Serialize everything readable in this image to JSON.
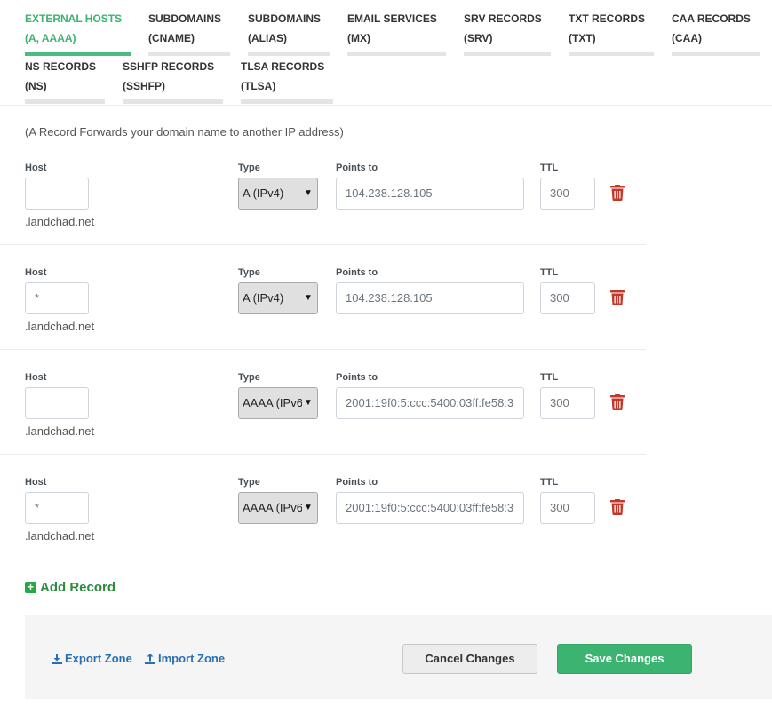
{
  "tabs": [
    {
      "line1": "EXTERNAL HOSTS",
      "line2": "(A, AAAA)",
      "active": true
    },
    {
      "line1": "SUBDOMAINS",
      "line2": "(CNAME)",
      "active": false
    },
    {
      "line1": "SUBDOMAINS",
      "line2": "(ALIAS)",
      "active": false
    },
    {
      "line1": "EMAIL SERVICES",
      "line2": "(MX)",
      "active": false
    },
    {
      "line1": "SRV RECORDS",
      "line2": "(SRV)",
      "active": false
    },
    {
      "line1": "TXT RECORDS",
      "line2": "(TXT)",
      "active": false
    },
    {
      "line1": "CAA RECORDS",
      "line2": "(CAA)",
      "active": false
    },
    {
      "line1": "NS RECORDS",
      "line2": "(NS)",
      "active": false
    },
    {
      "line1": "SSHFP RECORDS",
      "line2": "(SSHFP)",
      "active": false
    },
    {
      "line1": "TLSA RECORDS",
      "line2": "(TLSA)",
      "active": false
    }
  ],
  "description": "(A Record Forwards your domain name to another IP address)",
  "labels": {
    "host": "Host",
    "type": "Type",
    "points_to": "Points to",
    "ttl": "TTL"
  },
  "domain_suffix": ".landchad.net",
  "records": [
    {
      "host": "",
      "type": "A (IPv4)",
      "points_to": "104.238.128.105",
      "ttl": "300"
    },
    {
      "host": "*",
      "type": "A (IPv4)",
      "points_to": "104.238.128.105",
      "ttl": "300"
    },
    {
      "host": "",
      "type": "AAAA (IPv6",
      "points_to": "2001:19f0:5:ccc:5400:03ff:fe58:3",
      "ttl": "300"
    },
    {
      "host": "*",
      "type": "AAAA (IPv6",
      "points_to": "2001:19f0:5:ccc:5400:03ff:fe58:3",
      "ttl": "300"
    }
  ],
  "add_record_label": "Add Record",
  "footer": {
    "export_label": "Export Zone",
    "import_label": "Import Zone",
    "cancel_label": "Cancel Changes",
    "save_label": "Save Changes"
  },
  "colors": {
    "active_tab": "#3cb371",
    "save_button": "#3cb371",
    "trash_icon": "#c0392b",
    "link": "#2a6fb0"
  },
  "icons": {
    "trash": "trash-icon",
    "add": "plus-square-icon",
    "export": "download-icon",
    "import": "upload-icon",
    "select_caret": "chevron-down-icon"
  }
}
